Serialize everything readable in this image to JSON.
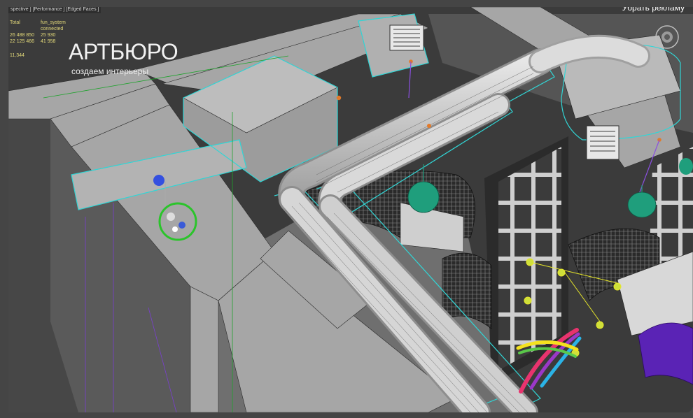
{
  "viewport": {
    "label_parts": [
      "spective ]",
      " [Performance ]",
      " [Edged Faces ]"
    ],
    "stats": {
      "rows": [
        {
          "label": "Total",
          "value1": "fun_system connected"
        },
        {
          "label": "26 488 850",
          "value1": "25 930"
        },
        {
          "label": "22 125 466",
          "value1": "41 958"
        }
      ],
      "fps": "11,344"
    }
  },
  "header": {
    "top_right_text": "Убрать рекламу"
  },
  "brand": {
    "name": "АРТБЮРО",
    "slogan": "создаем интерьеры",
    "colors": [
      "#e8336e",
      "#9b38c8",
      "#2bb3e6",
      "#f4e21e",
      "#5ac84a"
    ]
  },
  "scene": {
    "colors": {
      "background": "#3a3a3a",
      "walls": "#9a9a9a",
      "selection_outline": "#31d6d6",
      "light_marker": "#e27a2a",
      "lamp": "#1f9e7c",
      "wireframe_sofa": "#151515",
      "ceiling_wire": "#7a3fd0"
    },
    "icons": [
      "vent-grille-icon",
      "pendant-lamp-icon",
      "light-target-icon",
      "view-cube-icon"
    ]
  }
}
